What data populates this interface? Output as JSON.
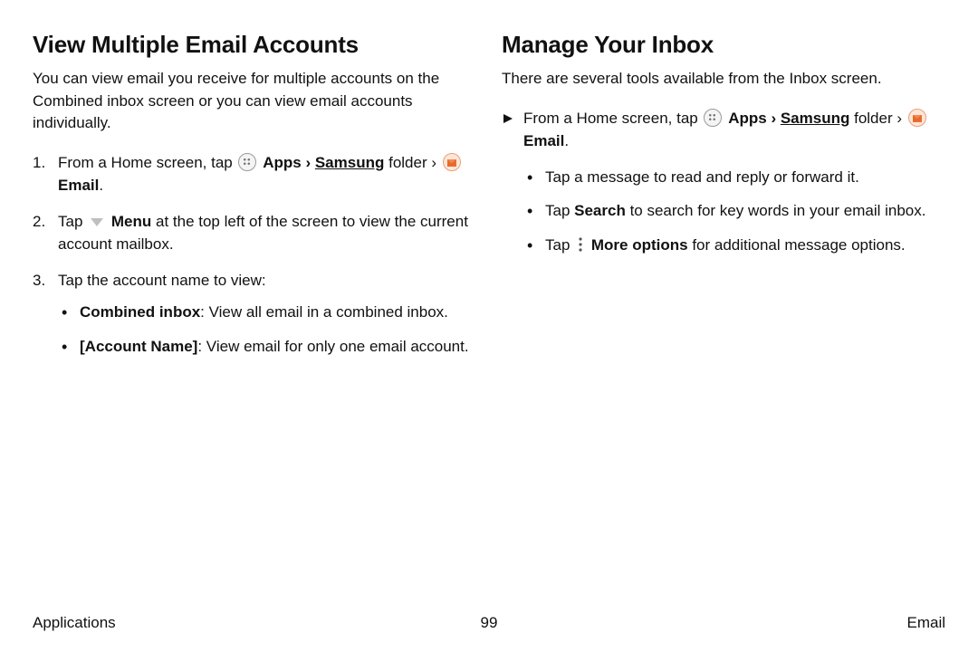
{
  "left": {
    "title": "View Multiple Email Accounts",
    "intro": "You can view email you receive for multiple accounts on the Combined inbox screen or you can view email accounts individually.",
    "step1": {
      "num": "1.",
      "t1": "From a Home screen, tap ",
      "apps_label": "Apps",
      "chev1": " › ",
      "samsung_label": "Samsung",
      "folder_word": " folder › ",
      "email_label": "Email",
      "period": "."
    },
    "step2": {
      "num": "2.",
      "t1": "Tap ",
      "menu_label": "Menu",
      "t2": " at the top left of the screen to view the current account mailbox."
    },
    "step3": {
      "num": "3.",
      "t1": "Tap the account name to view:",
      "b1_bold": "Combined inbox",
      "b1_rest": ": View all email in a combined inbox.",
      "b2_bold": "[Account Name]",
      "b2_rest": ": View email for only one email account."
    }
  },
  "right": {
    "title": "Manage Your Inbox",
    "intro": "There are several tools available from the Inbox screen.",
    "pi": {
      "t1": "From a Home screen, tap ",
      "apps_label": "Apps",
      "chev1": " › ",
      "samsung_label": "Samsung",
      "folder_word": " folder › ",
      "email_label": "Email",
      "period": "."
    },
    "b1": "Tap a message to read and reply or forward it.",
    "b2_t1": "Tap ",
    "b2_bold": "Search",
    "b2_t2": " to search for key words in your email inbox.",
    "b3_t1": "Tap ",
    "b3_bold": "More options",
    "b3_t2": " for additional message options."
  },
  "footer": {
    "left": "Applications",
    "page": "99",
    "right": "Email"
  }
}
